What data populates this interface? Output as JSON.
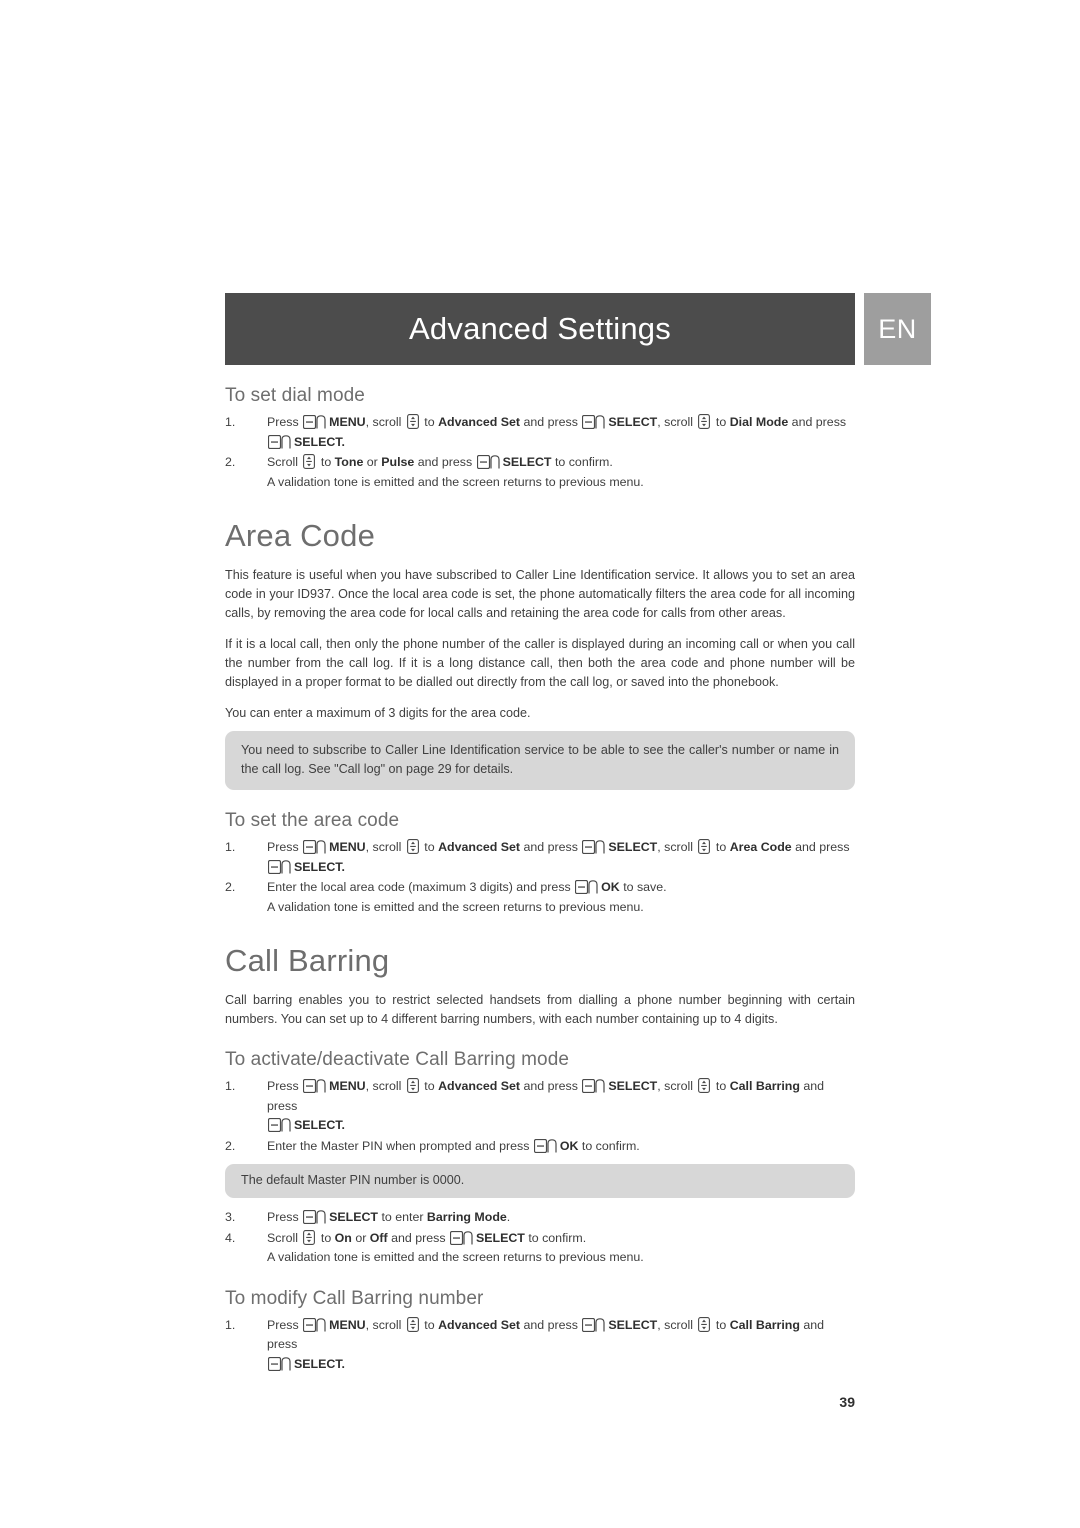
{
  "header": {
    "title": "Advanced Settings",
    "language_badge": "EN"
  },
  "sections": [
    {
      "id": "to-set-dial-mode",
      "sub_heading": "To set dial mode",
      "steps": [
        {
          "num": "1.",
          "lines": [
            "Press [softkey] MENU, scroll [navkey] to Advanced Set and press [softkey] SELECT, scroll [navkey] to Dial Mode and press",
            "[softkey] SELECT."
          ]
        },
        {
          "num": "2.",
          "lines": [
            "Scroll [navkey] to Tone or Pulse and press [softkey] SELECT to confirm.",
            "A validation tone is emitted and the screen returns to previous menu."
          ]
        }
      ]
    },
    {
      "id": "area-code",
      "heading": "Area Code",
      "paragraphs": [
        "This feature is useful when you have subscribed to Caller Line Identification service. It allows you to set an area code in your ID937. Once the local area code is set, the phone automatically filters the area code for all incoming calls, by removing the area code for local calls and retaining the area code for calls from other areas.",
        "If it is a local call, then only the phone number of the caller is displayed during an incoming call or when you call the number from the call log. If it is a long distance call, then both the area code and phone number will be displayed in a proper format to be dialled out directly from the call log, or saved into the phonebook.",
        "You can enter a maximum of 3 digits for the area code."
      ],
      "note": "You need to subscribe to Caller Line Identification service to be able to see the caller's number or name in the call log. See \"Call log\" on page 29 for details."
    },
    {
      "id": "to-set-the-area-code",
      "sub_heading": "To set the area code",
      "steps": [
        {
          "num": "1.",
          "lines": [
            "Press [softkey] MENU, scroll [navkey] to Advanced Set and press [softkey] SELECT, scroll [navkey] to Area Code and press",
            "[softkey] SELECT."
          ]
        },
        {
          "num": "2.",
          "lines": [
            "Enter the local area code (maximum 3 digits) and press [softkey] OK to save.",
            "A validation tone is emitted and the screen returns to previous menu."
          ]
        }
      ]
    },
    {
      "id": "call-barring",
      "heading": "Call Barring",
      "paragraphs": [
        "Call barring enables you to restrict selected handsets from dialling a phone number beginning with certain numbers. You can set up to 4 different barring numbers, with each number containing up to 4 digits."
      ]
    },
    {
      "id": "activate-deactivate-call-barring",
      "sub_heading": "To activate/deactivate Call Barring mode",
      "steps": [
        {
          "num": "1.",
          "lines": [
            "Press [softkey] MENU, scroll [navkey] to Advanced Set and press [softkey] SELECT, scroll [navkey] to Call Barring and press",
            "[softkey] SELECT."
          ]
        },
        {
          "num": "2.",
          "lines": [
            "Enter the Master PIN when prompted and press [softkey] OK to confirm."
          ]
        }
      ],
      "note": "The default Master PIN number is 0000.",
      "steps_after": [
        {
          "num": "3.",
          "lines": [
            "Press [softkey] SELECT to enter Barring Mode."
          ]
        },
        {
          "num": "4.",
          "lines": [
            "Scroll [navkey] to On or Off and press [softkey] SELECT to confirm.",
            "A validation tone is emitted and the screen returns to previous menu."
          ]
        }
      ]
    },
    {
      "id": "modify-call-barring-number",
      "sub_heading": "To modify Call Barring number",
      "steps": [
        {
          "num": "1.",
          "lines": [
            "Press [softkey] MENU, scroll [navkey] to Advanced Set and press [softkey] SELECT, scroll [navkey] to Call Barring and press",
            "[softkey] SELECT."
          ]
        }
      ]
    }
  ],
  "text": {
    "dial_mode_step1_a": "Press ",
    "menu_label": "MENU",
    "scroll_word": ", scroll ",
    "to_word": " to ",
    "advanced_set": "Advanced Set",
    "and_press": " and press ",
    "select_label": "SELECT",
    "comma_scroll": ", scroll ",
    "dial_mode": "Dial Mode",
    "and_press2": " and press",
    "select_dot": "SELECT.",
    "step2_scroll": "Scroll ",
    "tone": "Tone",
    "or_word": " or ",
    "pulse": "Pulse",
    "and_press_confirm": " and press ",
    "to_confirm": " to confirm.",
    "validation_tone": "A validation tone is emitted and the screen returns to previous menu.",
    "area_code_label": "Area Code",
    "area_step2": "Enter the local area code (maximum 3 digits) and press ",
    "ok_label": "OK",
    "to_save": " to save.",
    "call_barring_label": "Call Barring",
    "cb_step2": "Enter the Master PIN when prompted and press ",
    "to_confirm2": " to confirm.",
    "cb_step3_a": "Press ",
    "cb_step3_b": " to enter ",
    "barring_mode": "Barring Mode",
    "period": ".",
    "cb_step4_on": "On",
    "cb_step4_off": "Off"
  },
  "page_number": "39",
  "colors": {
    "banner_bg": "#4c4c4c",
    "lang_bg": "#9e9e9e",
    "heading": "#6e6e6e",
    "note_bg": "#d7d7d7",
    "body_text": "#3f3f3f"
  }
}
